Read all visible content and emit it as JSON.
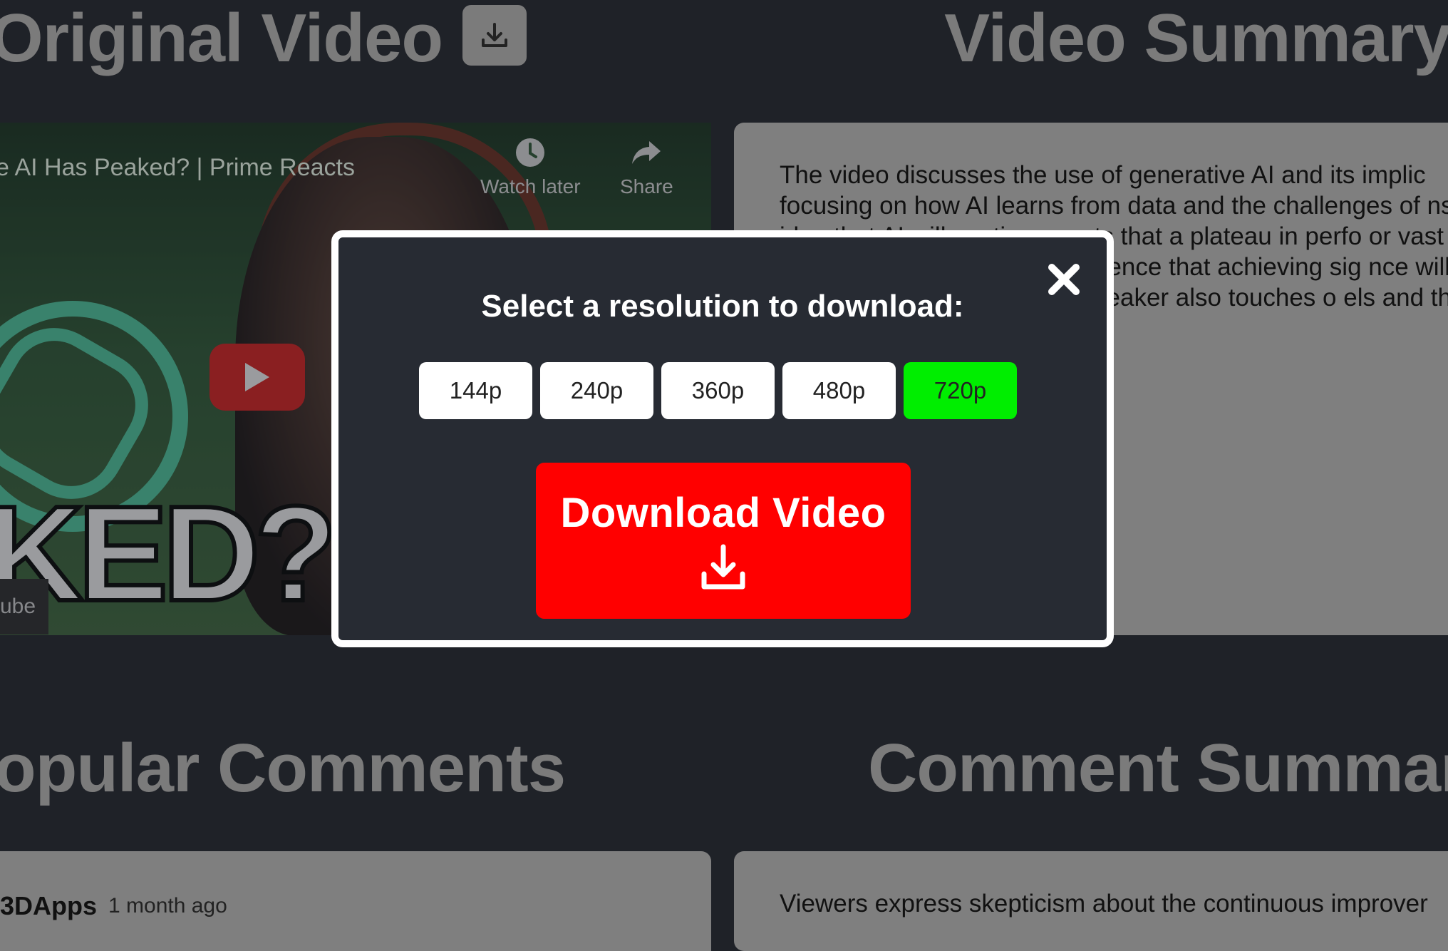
{
  "sections": {
    "original_video_title": "Original Video",
    "video_summary_title": "Video Summary",
    "popular_comments_title": "opular Comments",
    "comment_summary_title": "Comment Summar"
  },
  "video": {
    "title": "e AI Has Peaked? | Prime Reacts",
    "watch_later_label": "Watch later",
    "share_label": "Share",
    "thumbnail_text": "KED?",
    "brand_text": "ube"
  },
  "summary": {
    "text": "The video discusses the use of generative AI and its implic focusing on how AI learns from data and the challenges of ns the idea that AI will continu ggests that a plateau in perfo or vast amounts of data. The nts evidence that achieving sig nce will require exponentially . The speaker also touches o els and the challenges of solvi answers."
  },
  "comments": {
    "author": "3DApps",
    "time": "1 month ago"
  },
  "comment_summary": {
    "text": "Viewers express skepticism about the continuous improver"
  },
  "modal": {
    "title": "Select a resolution to download:",
    "resolutions": [
      "144p",
      "240p",
      "360p",
      "480p",
      "720p"
    ],
    "selected": "720p",
    "download_label": "Download Video"
  },
  "colors": {
    "background": "#1f2228",
    "modal_bg": "#272b33",
    "selected_res": "#00ee00",
    "download_btn": "#ff0000"
  }
}
